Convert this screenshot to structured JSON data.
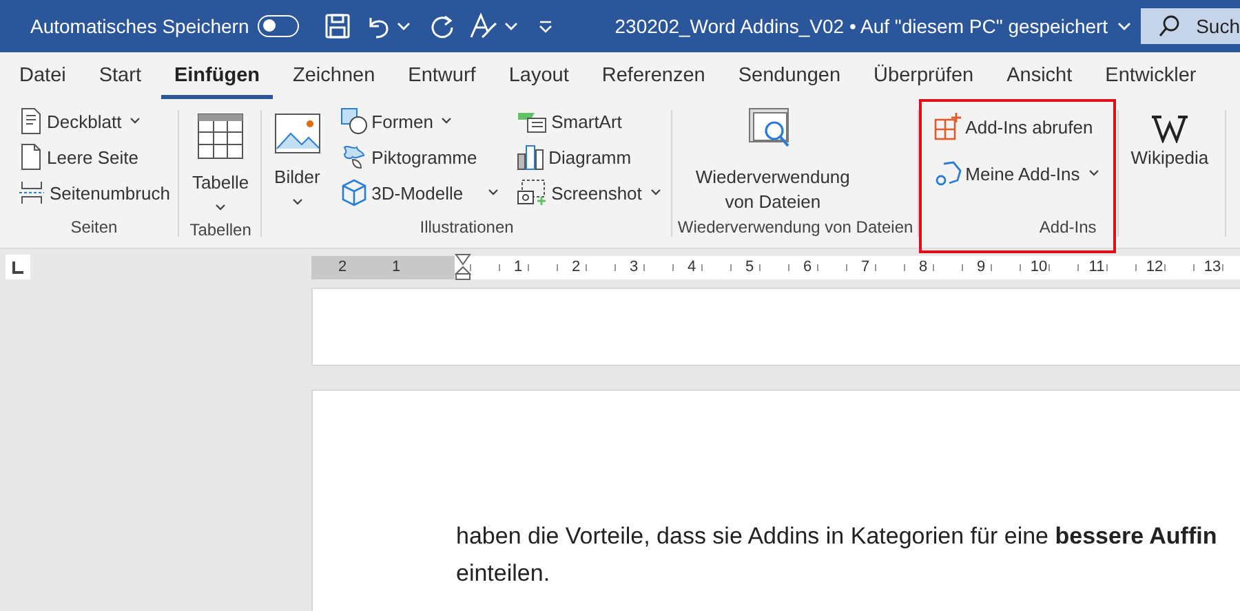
{
  "title_bar": {
    "autosave_label": "Automatisches Speichern",
    "autosave_on": false,
    "document_title": "230202_Word Addins_V02 • Auf \"diesem PC\" gespeichert",
    "search_placeholder": "Such"
  },
  "tabs": [
    {
      "label": "Datei",
      "selected": false
    },
    {
      "label": "Start",
      "selected": false
    },
    {
      "label": "Einfügen",
      "selected": true
    },
    {
      "label": "Zeichnen",
      "selected": false
    },
    {
      "label": "Entwurf",
      "selected": false
    },
    {
      "label": "Layout",
      "selected": false
    },
    {
      "label": "Referenzen",
      "selected": false
    },
    {
      "label": "Sendungen",
      "selected": false
    },
    {
      "label": "Überprüfen",
      "selected": false
    },
    {
      "label": "Ansicht",
      "selected": false
    },
    {
      "label": "Entwickler",
      "selected": false
    }
  ],
  "ribbon_groups": [
    {
      "label": "Seiten",
      "highlighted": false,
      "columns": [
        {
          "kind": "stack",
          "items": [
            {
              "label": "Deckblatt",
              "dropdown": true
            },
            {
              "label": "Leere Seite",
              "dropdown": false
            },
            {
              "label": "Seitenumbruch",
              "dropdown": false
            }
          ]
        }
      ]
    },
    {
      "label": "Tabellen",
      "highlighted": false,
      "columns": [
        {
          "kind": "large",
          "items": [
            {
              "label": "Tabelle",
              "dropdown": true
            }
          ]
        }
      ]
    },
    {
      "label": "Illustrationen",
      "highlighted": false,
      "columns": [
        {
          "kind": "large",
          "items": [
            {
              "label": "Bilder",
              "dropdown": true
            }
          ]
        },
        {
          "kind": "stack",
          "items": [
            {
              "label": "Formen",
              "dropdown": true
            },
            {
              "label": "Piktogramme",
              "dropdown": false
            },
            {
              "label": "3D-Modelle",
              "dropdown": true
            }
          ]
        },
        {
          "kind": "stack",
          "items": [
            {
              "label": "SmartArt",
              "dropdown": false
            },
            {
              "label": "Diagramm",
              "dropdown": false
            },
            {
              "label": "Screenshot",
              "dropdown": true
            }
          ]
        }
      ]
    },
    {
      "label": "Wiederverwendung von Dateien",
      "highlighted": false,
      "columns": [
        {
          "kind": "large",
          "items": [
            {
              "label": "Wiederverwendung von Dateien",
              "dropdown": false
            }
          ]
        }
      ]
    },
    {
      "label": "Add-Ins",
      "highlighted": true,
      "columns": [
        {
          "kind": "stack",
          "items": [
            {
              "label": "Add-Ins abrufen",
              "dropdown": false
            },
            {
              "label": "Meine Add-Ins",
              "dropdown": true
            }
          ]
        }
      ]
    },
    {
      "highlighted": false,
      "columns": [
        {
          "kind": "large",
          "items": [
            {
              "label": "Wikipedia",
              "dropdown": false
            }
          ]
        }
      ]
    }
  ],
  "ruler": {
    "left_numbers": [
      "2",
      "1"
    ],
    "right_numbers": [
      "1",
      "2",
      "3",
      "4",
      "5",
      "6",
      "7",
      "8",
      "9",
      "10",
      "11",
      "12",
      "13"
    ]
  },
  "document": {
    "paragraph": "haben die Vorteile, dass sie Addins in Kategorien für eine **bessere Auffin**",
    "continuation": "einteilen."
  }
}
